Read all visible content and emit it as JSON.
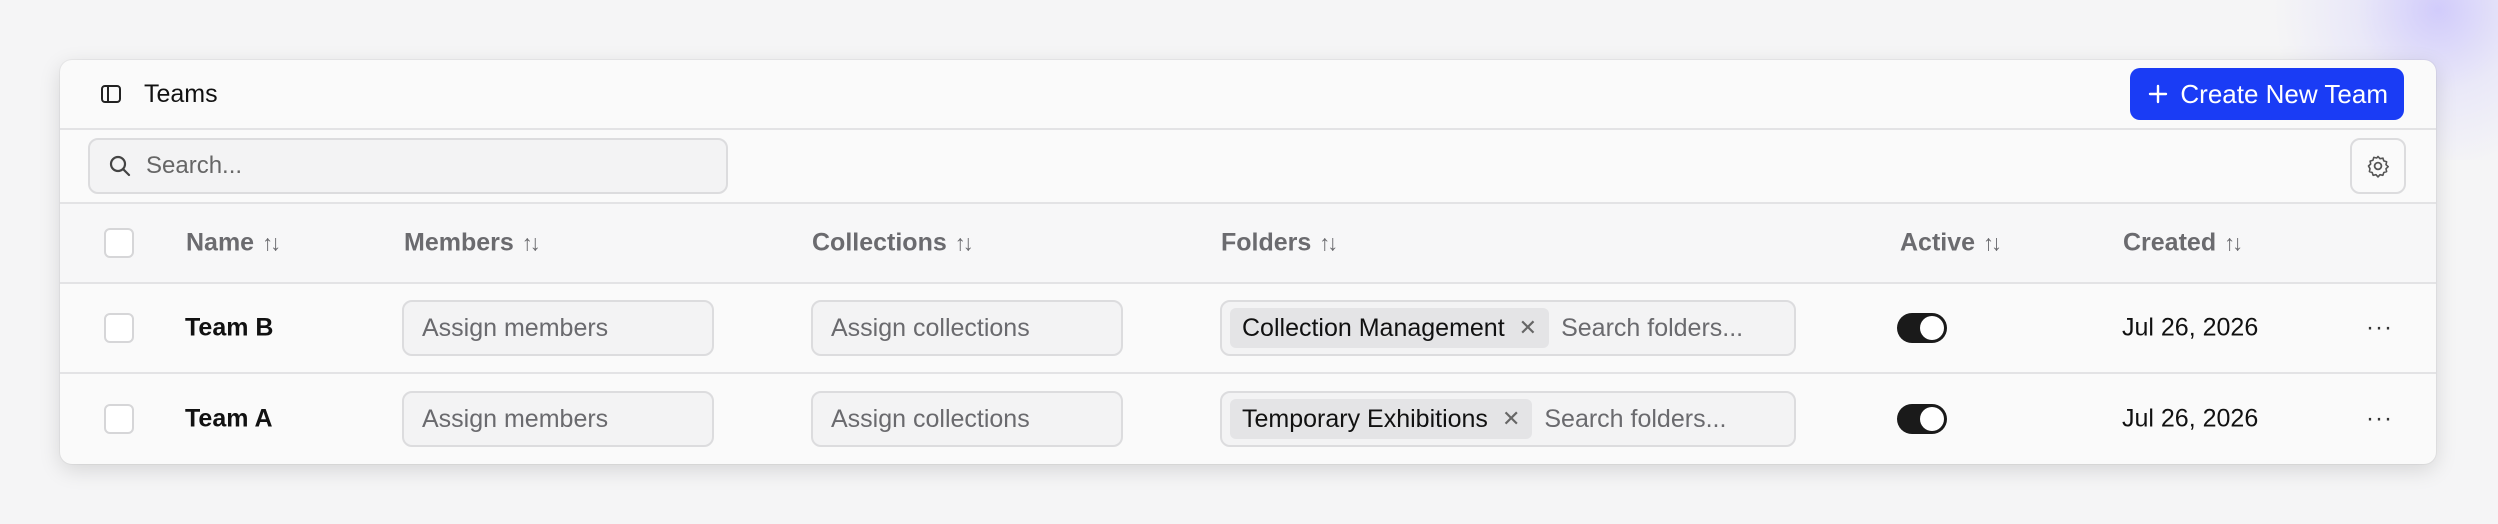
{
  "header": {
    "title": "Teams",
    "create_button_label": "Create New Team"
  },
  "toolbar": {
    "search_placeholder": "Search..."
  },
  "table": {
    "columns": [
      "Name",
      "Members",
      "Collections",
      "Folders",
      "Active",
      "Created"
    ],
    "rows": [
      {
        "name": "Team B",
        "members_placeholder": "Assign members",
        "collections_placeholder": "Assign collections",
        "folder_tag": "Collection Management",
        "folder_placeholder": "Search folders...",
        "active": true,
        "created": "Jul 26, 2026",
        "more": "···"
      },
      {
        "name": "Team A",
        "members_placeholder": "Assign members",
        "collections_placeholder": "Assign collections",
        "folder_tag": "Temporary Exhibitions",
        "folder_placeholder": "Search folders...",
        "active": true,
        "created": "Jul 26, 2026",
        "more": "···"
      }
    ]
  },
  "icons": {
    "sidebar": "sidebar-toggle-icon",
    "plus": "plus-icon",
    "search": "search-icon",
    "settings": "gear-icon",
    "sort": "sort-icon",
    "remove": "close-icon",
    "more": "more-horizontal-icon"
  },
  "colors": {
    "accent": "#1a3cf5",
    "toggle_on": "#1a1a1a"
  }
}
